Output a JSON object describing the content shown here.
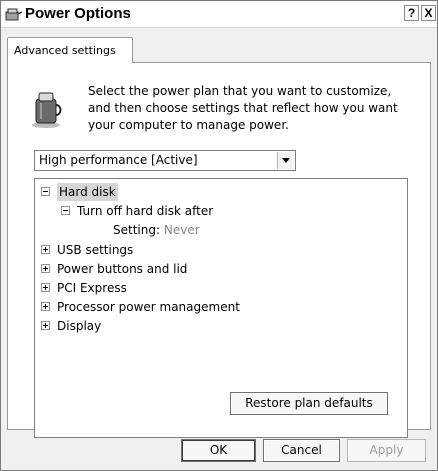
{
  "window": {
    "title": "Power Options",
    "help_button": "?",
    "close_button": "X"
  },
  "tabs": [
    {
      "label": "Advanced settings",
      "active": true
    }
  ],
  "intro": {
    "text": "Select the power plan that you want to customize, and then choose settings that reflect how you want your computer to manage power."
  },
  "plan_select": {
    "value": "High performance [Active]"
  },
  "tree": {
    "items": [
      {
        "label": "Hard disk",
        "expander": "minus",
        "selected": true
      },
      {
        "label": "Turn off hard disk after",
        "expander": "minus"
      },
      {
        "setting_label": "Setting:",
        "setting_value": "Never"
      },
      {
        "label": "USB settings",
        "expander": "plus"
      },
      {
        "label": "Power buttons and lid",
        "expander": "plus"
      },
      {
        "label": "PCI Express",
        "expander": "plus"
      },
      {
        "label": "Processor power management",
        "expander": "plus"
      },
      {
        "label": "Display",
        "expander": "plus"
      }
    ]
  },
  "buttons": {
    "restore": "Restore plan defaults",
    "ok": "OK",
    "cancel": "Cancel",
    "apply": "Apply"
  },
  "icons": {
    "title": "power-options-icon",
    "intro": "power-plan-icon"
  }
}
